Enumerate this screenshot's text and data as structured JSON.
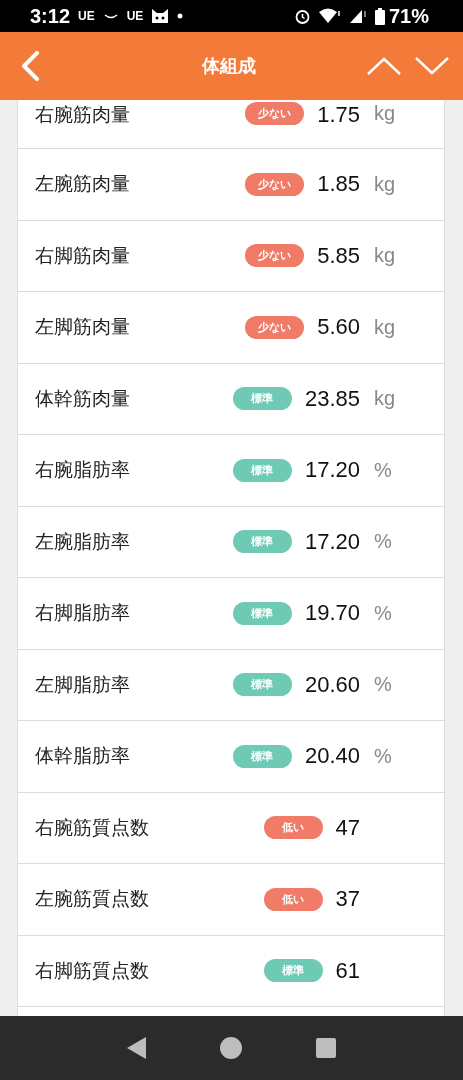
{
  "status_bar": {
    "time": "3:12",
    "carriers": [
      "UE",
      "UE"
    ],
    "battery": "71%"
  },
  "header": {
    "title": "体組成"
  },
  "rows": [
    {
      "label": "右腕筋肉量",
      "badge": {
        "text": "少ない",
        "kind": "low"
      },
      "value": "1.75",
      "unit": "kg",
      "partial": true
    },
    {
      "label": "左腕筋肉量",
      "badge": {
        "text": "少ない",
        "kind": "low"
      },
      "value": "1.85",
      "unit": "kg"
    },
    {
      "label": "右脚筋肉量",
      "badge": {
        "text": "少ない",
        "kind": "low"
      },
      "value": "5.85",
      "unit": "kg"
    },
    {
      "label": "左脚筋肉量",
      "badge": {
        "text": "少ない",
        "kind": "low"
      },
      "value": "5.60",
      "unit": "kg"
    },
    {
      "label": "体幹筋肉量",
      "badge": {
        "text": "標準",
        "kind": "standard"
      },
      "value": "23.85",
      "unit": "kg"
    },
    {
      "label": "右腕脂肪率",
      "badge": {
        "text": "標準",
        "kind": "standard"
      },
      "value": "17.20",
      "unit": "%"
    },
    {
      "label": "左腕脂肪率",
      "badge": {
        "text": "標準",
        "kind": "standard"
      },
      "value": "17.20",
      "unit": "%"
    },
    {
      "label": "右脚脂肪率",
      "badge": {
        "text": "標準",
        "kind": "standard"
      },
      "value": "19.70",
      "unit": "%"
    },
    {
      "label": "左脚脂肪率",
      "badge": {
        "text": "標準",
        "kind": "standard"
      },
      "value": "20.60",
      "unit": "%"
    },
    {
      "label": "体幹脂肪率",
      "badge": {
        "text": "標準",
        "kind": "standard"
      },
      "value": "20.40",
      "unit": "%"
    },
    {
      "label": "右腕筋質点数",
      "badge": {
        "text": "低い",
        "kind": "low"
      },
      "value": "47"
    },
    {
      "label": "左腕筋質点数",
      "badge": {
        "text": "低い",
        "kind": "low"
      },
      "value": "37"
    },
    {
      "label": "右脚筋質点数",
      "badge": {
        "text": "標準",
        "kind": "standard"
      },
      "value": "61"
    }
  ]
}
